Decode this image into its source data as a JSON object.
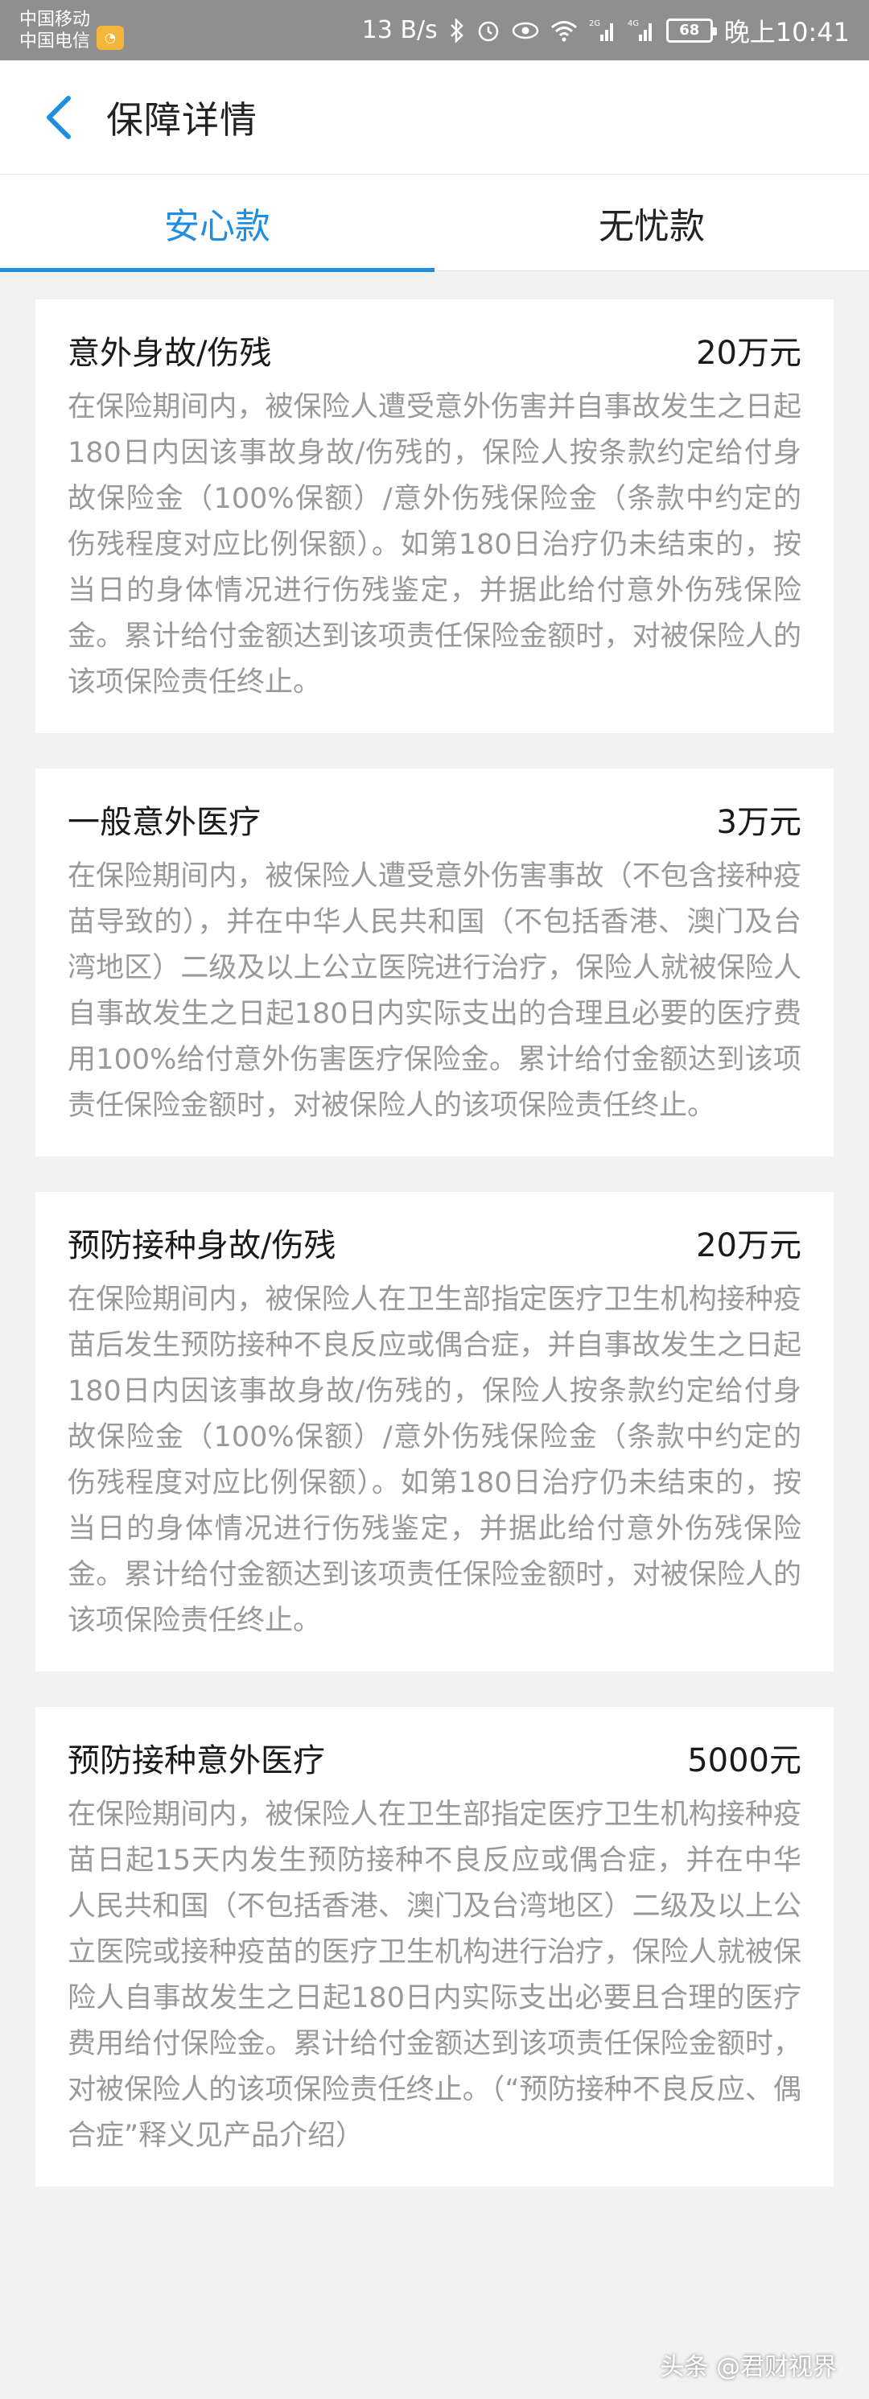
{
  "status_bar": {
    "carrier1": "中国移动",
    "carrier2": "中国电信",
    "speed": "13 B/s",
    "net1": "2G",
    "net2": "4G",
    "battery": "68",
    "time": "晚上10:41",
    "icons": [
      "bluetooth-icon",
      "alarm-icon",
      "eye-icon",
      "wifi-icon",
      "signal-icon",
      "signal-icon",
      "battery-icon"
    ]
  },
  "header": {
    "title": "保障详情"
  },
  "tabs": [
    {
      "label": "安心款",
      "active": true
    },
    {
      "label": "无忧款",
      "active": false
    }
  ],
  "cards": [
    {
      "title": "意外身故/伤残",
      "amount": "20万元",
      "desc": "在保险期间内，被保险人遭受意外伤害并自事故发生之日起180日内因该事故身故/伤残的，保险人按条款约定给付身故保险金（100%保额）/意外伤残保险金（条款中约定的伤残程度对应比例保额）。如第180日治疗仍未结束的，按当日的身体情况进行伤残鉴定，并据此给付意外伤残保险金。累计给付金额达到该项责任保险金额时，对被保险人的该项保险责任终止。"
    },
    {
      "title": "一般意外医疗",
      "amount": "3万元",
      "desc": "在保险期间内，被保险人遭受意外伤害事故（不包含接种疫苗导致的），并在中华人民共和国（不包括香港、澳门及台湾地区）二级及以上公立医院进行治疗，保险人就被保险人自事故发生之日起180日内实际支出的合理且必要的医疗费用100%给付意外伤害医疗保险金。累计给付金额达到该项责任保险金额时，对被保险人的该项保险责任终止。"
    },
    {
      "title": "预防接种身故/伤残",
      "amount": "20万元",
      "desc": "在保险期间内，被保险人在卫生部指定医疗卫生机构接种疫苗后发生预防接种不良反应或偶合症，并自事故发生之日起180日内因该事故身故/伤残的，保险人按条款约定给付身故保险金（100%保额）/意外伤残保险金（条款中约定的伤残程度对应比例保额）。如第180日治疗仍未结束的，按当日的身体情况进行伤残鉴定，并据此给付意外伤残保险金。累计给付金额达到该项责任保险金额时，对被保险人的该项保险责任终止。"
    },
    {
      "title": "预防接种意外医疗",
      "amount": "5000元",
      "desc": "在保险期间内，被保险人在卫生部指定医疗卫生机构接种疫苗日起15天内发生预防接种不良反应或偶合症，并在中华人民共和国（不包括香港、澳门及台湾地区）二级及以上公立医院或接种疫苗的医疗卫生机构进行治疗，保险人就被保险人自事故发生之日起180日内实际支出必要且合理的医疗费用给付保险金。累计给付金额达到该项责任保险金额时，对被保险人的该项保险责任终止。（“预防接种不良反应、偶合症”释义见产品介绍）"
    }
  ],
  "watermark": {
    "text": "头条 @君财视界"
  },
  "colors": {
    "accent": "#1f8ee0",
    "status_bar": "#8f8f8f",
    "background": "#f2f2f2",
    "desc_text": "#999999"
  }
}
